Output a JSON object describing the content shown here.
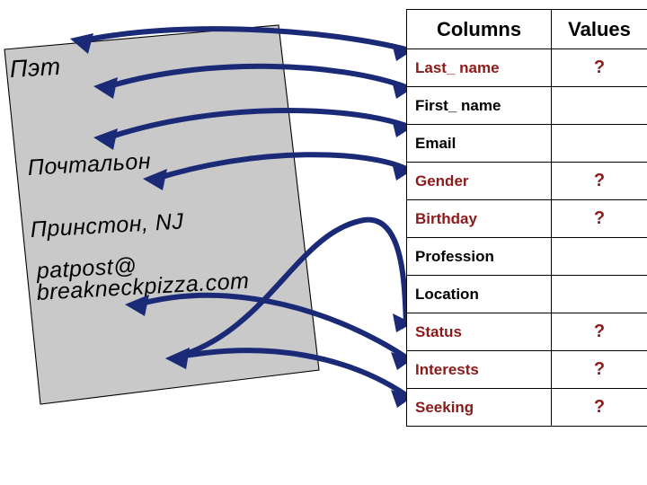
{
  "card": {
    "name": "Пэт",
    "job": "Почтальон",
    "city": "Принстон, NJ",
    "email_line1": "patpost@",
    "email_line2": "breakneckpizza.com",
    "fill_color": "#c9c9c9",
    "border_color": "#000000"
  },
  "arrows": {
    "color": "#1b2a77",
    "count": 7,
    "style": "double-headed-curve"
  },
  "table": {
    "header": {
      "columns_label": "Columns",
      "values_label": "Values"
    },
    "highlight_color": "#8b1a1a",
    "text_color": "#000000",
    "unknown_marker": "?",
    "rows": [
      {
        "column": "Last_ name",
        "value": "?",
        "marked": true
      },
      {
        "column": "First_ name",
        "value": "",
        "marked": false
      },
      {
        "column": "Email",
        "value": "",
        "marked": false
      },
      {
        "column": "Gender",
        "value": "?",
        "marked": true
      },
      {
        "column": "Birthday",
        "value": "?",
        "marked": true
      },
      {
        "column": "Profession",
        "value": "",
        "marked": false
      },
      {
        "column": "Location",
        "value": "",
        "marked": false
      },
      {
        "column": "Status",
        "value": "?",
        "marked": true
      },
      {
        "column": "Interests",
        "value": "?",
        "marked": true
      },
      {
        "column": "Seeking",
        "value": "?",
        "marked": true
      }
    ]
  }
}
